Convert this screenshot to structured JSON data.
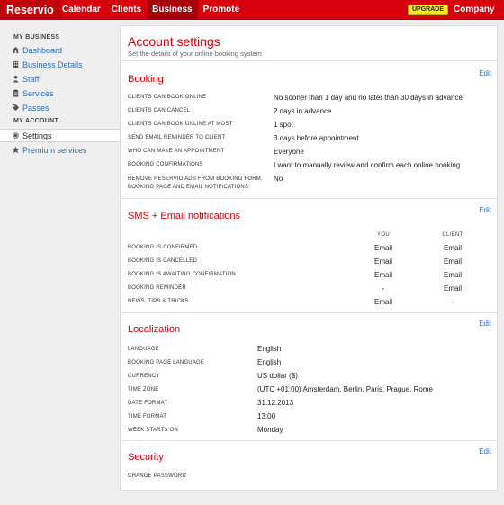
{
  "topbar": {
    "logo": "Reservio",
    "nav": [
      {
        "label": "Calendar",
        "active": false
      },
      {
        "label": "Clients",
        "active": false
      },
      {
        "label": "Business",
        "active": true
      },
      {
        "label": "Promote",
        "active": false
      }
    ],
    "upgrade_label": "UPGRADE",
    "company_label": "Company"
  },
  "sidebar": {
    "my_business_heading": "MY BUSINESS",
    "my_account_heading": "MY ACCOUNT",
    "items": [
      {
        "label": "Dashboard",
        "icon": "home-icon"
      },
      {
        "label": "Business Details",
        "icon": "building-icon"
      },
      {
        "label": "Staff",
        "icon": "person-icon"
      },
      {
        "label": "Services",
        "icon": "clipboard-icon"
      },
      {
        "label": "Passes",
        "icon": "tag-icon"
      }
    ],
    "account_items": [
      {
        "label": "Settings",
        "icon": "gear-icon",
        "active": true
      },
      {
        "label": "Premium services",
        "icon": "star-icon"
      }
    ]
  },
  "main": {
    "title": "Account settings",
    "subtitle": "Set the details of your online booking system",
    "edit_label": "Edit",
    "booking": {
      "title": "Booking",
      "rows": [
        {
          "label": "CLIENTS CAN BOOK ONLINE",
          "value": "No sooner than 1 day and no later than 30 days in advance"
        },
        {
          "label": "CLIENTS CAN CANCEL",
          "value": "2 days in advance"
        },
        {
          "label": "CLIENTS CAN BOOK ONLINE AT MOST",
          "value": "1 spot"
        },
        {
          "label": "SEND EMAIL REMINDER TO CLIENT",
          "value": "3 days before appointment"
        },
        {
          "label": "WHO CAN MAKE AN APPOINTMENT",
          "value": "Everyone"
        },
        {
          "label": "BOOKING CONFIRMATIONS",
          "value": "I want to manually review and confirm each online booking"
        },
        {
          "label": "REMOVE RESERVIO ADS FROM BOOKING FORM, BOOKING PAGE AND EMAIL NOTIFICATIONS",
          "value": "No"
        }
      ]
    },
    "notifications": {
      "title": "SMS + Email notifications",
      "col_you": "YOU",
      "col_client": "CLIENT",
      "rows": [
        {
          "label": "BOOKING IS CONFIRMED",
          "you": "Email",
          "client": "Email"
        },
        {
          "label": "BOOKING IS CANCELLED",
          "you": "Email",
          "client": "Email"
        },
        {
          "label": "BOOKING IS AWAITING CONFIRMATION",
          "you": "Email",
          "client": "Email"
        },
        {
          "label": "BOOKING REMINDER",
          "you": "-",
          "client": "Email"
        },
        {
          "label": "NEWS, TIPS & TRICKS",
          "you": "Email",
          "client": "-"
        }
      ]
    },
    "localization": {
      "title": "Localization",
      "rows": [
        {
          "label": "LANGUAGE",
          "value": "English"
        },
        {
          "label": "BOOKING PAGE LANGUAGE",
          "value": "English"
        },
        {
          "label": "CURRENCY",
          "value": "US dollar ($)"
        },
        {
          "label": "TIME ZONE",
          "value": "(UTC +01:00) Amsterdam, Berlin, Paris, Prague, Rome"
        },
        {
          "label": "DATE FORMAT",
          "value": "31.12.2013"
        },
        {
          "label": "TIME FORMAT",
          "value": "13:00"
        },
        {
          "label": "WEEK STARTS ON",
          "value": "Monday"
        }
      ]
    },
    "security": {
      "title": "Security",
      "change_password_label": "CHANGE PASSWORD"
    }
  },
  "colors": {
    "brand_red": "#d8000c",
    "link_blue": "#2a6cb8",
    "upgrade_yellow": "#f5e72b"
  }
}
